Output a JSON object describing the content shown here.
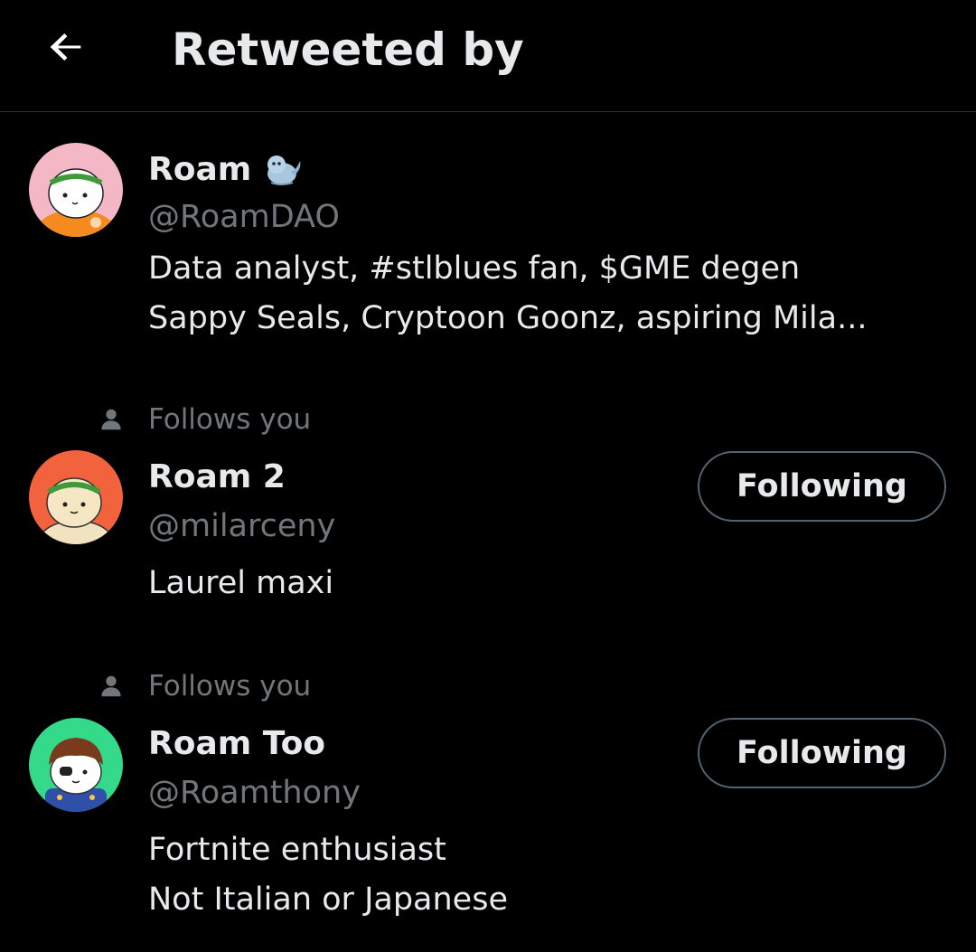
{
  "header": {
    "title": "Retweeted by",
    "back_icon": "arrow-left-icon"
  },
  "colors": {
    "background": "#000000",
    "primary_text": "#e7e9ea",
    "secondary_text": "#71767b",
    "divider": "#2f3336",
    "button_border": "#536471"
  },
  "users": [
    {
      "display_name": "Roam",
      "name_emoji": "seal-emoji",
      "handle": "@RoamDAO",
      "bio_lines": [
        "Data analyst, #stlblues fan, $GME degen",
        "Sappy Seals, Cryptoon Goonz, aspiring Mila..."
      ],
      "avatar": "pink-seal-laurel-avatar"
    },
    {
      "social_context": "Follows you",
      "social_icon": "person-icon",
      "display_name": "Roam 2",
      "handle": "@milarceny",
      "bio_lines": [
        "Laurel maxi"
      ],
      "follow_label": "Following",
      "avatar": "cream-seal-laurel-avatar"
    },
    {
      "social_context": "Follows you",
      "social_icon": "person-icon",
      "display_name": "Roam Too",
      "handle": "@Roamthony",
      "bio_lines": [
        "Fortnite enthusiast",
        "Not Italian or Japanese"
      ],
      "follow_label": "Following",
      "avatar": "green-seal-eyepatch-avatar"
    }
  ]
}
